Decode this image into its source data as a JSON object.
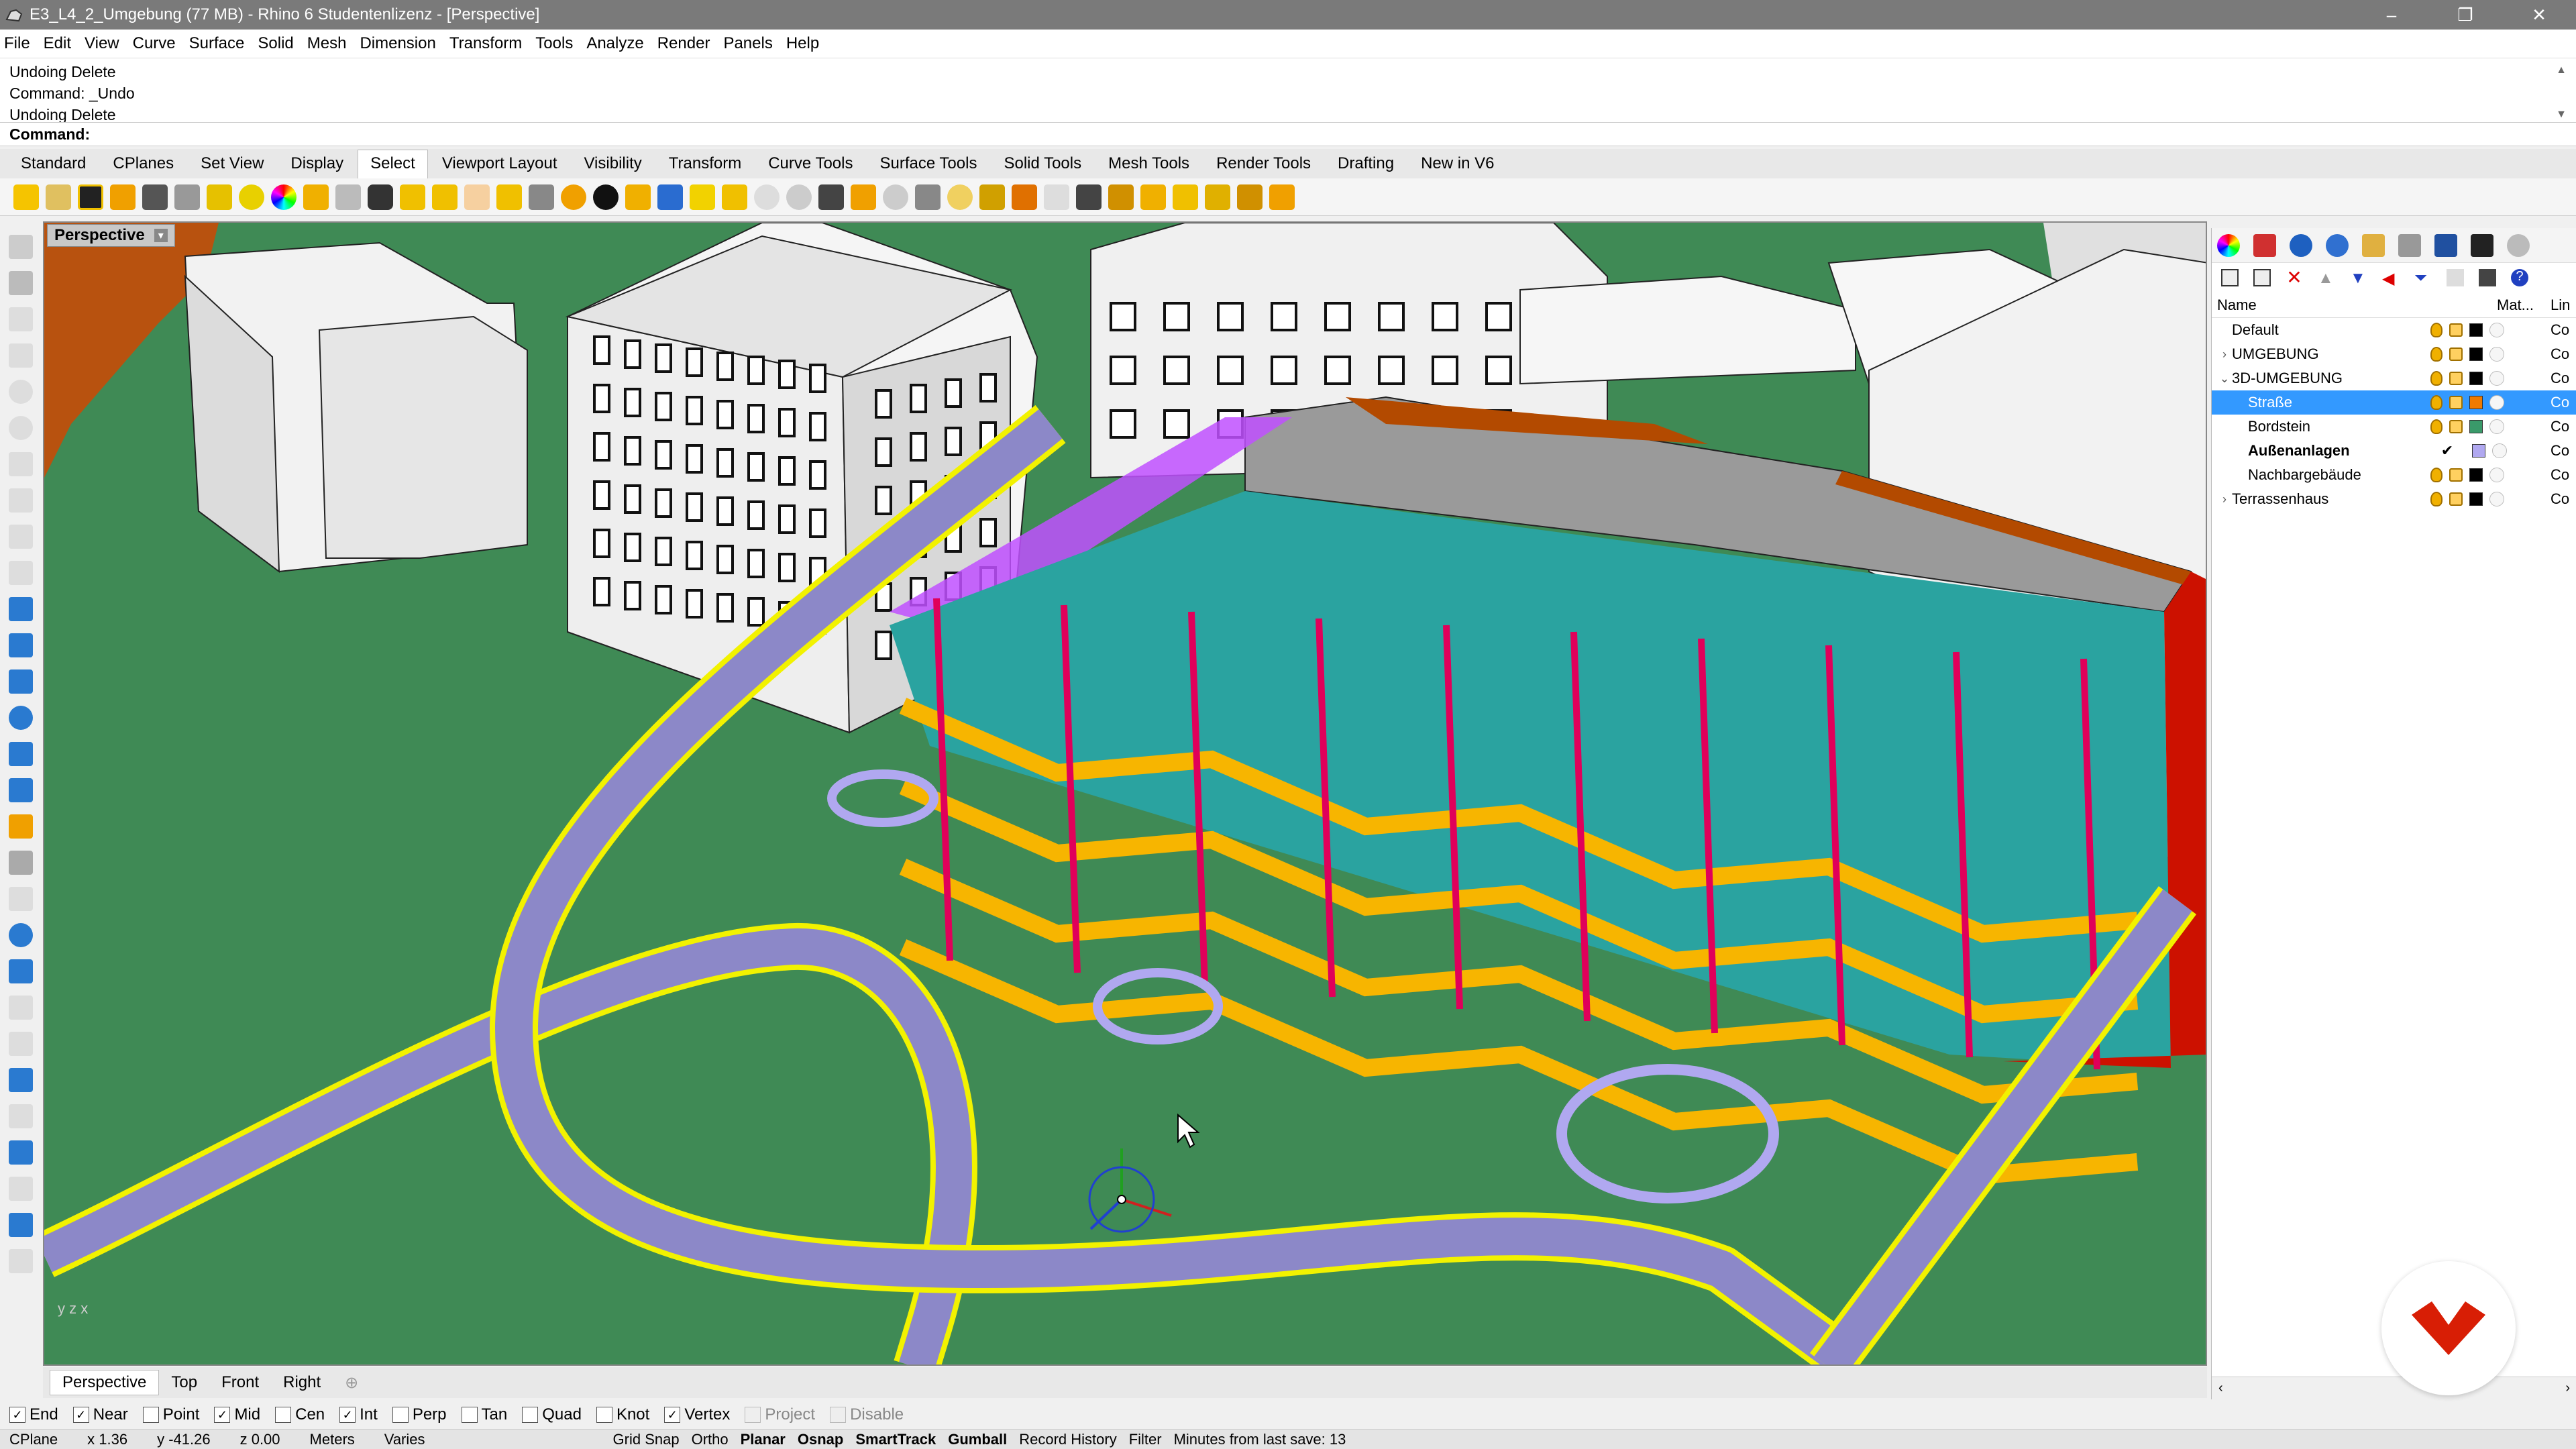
{
  "window": {
    "title": "E3_L4_2_Umgebung (77 MB) - Rhino 6 Studentenlizenz - [Perspective]",
    "min": "–",
    "max": "❐",
    "close": "✕"
  },
  "menu": [
    "File",
    "Edit",
    "View",
    "Curve",
    "Surface",
    "Solid",
    "Mesh",
    "Dimension",
    "Transform",
    "Tools",
    "Analyze",
    "Render",
    "Panels",
    "Help"
  ],
  "command": {
    "history": [
      "Undoing Delete",
      "Command: _Undo",
      "Undoing Delete"
    ],
    "prompt": "Command:"
  },
  "toolbar_tabs": [
    "Standard",
    "CPlanes",
    "Set View",
    "Display",
    "Select",
    "Viewport Layout",
    "Visibility",
    "Transform",
    "Curve Tools",
    "Surface Tools",
    "Solid Tools",
    "Mesh Tools",
    "Render Tools",
    "Drafting",
    "New in V6"
  ],
  "active_toolbar_tab": "Select",
  "viewport": {
    "name": "Perspective",
    "dropdown": "▾",
    "axis_labels": "y  z  x"
  },
  "viewport_tabs": [
    "Perspective",
    "Top",
    "Front",
    "Right",
    "⊕"
  ],
  "osnaps": [
    {
      "label": "End",
      "checked": true
    },
    {
      "label": "Near",
      "checked": true
    },
    {
      "label": "Point",
      "checked": false
    },
    {
      "label": "Mid",
      "checked": true
    },
    {
      "label": "Cen",
      "checked": false
    },
    {
      "label": "Int",
      "checked": true
    },
    {
      "label": "Perp",
      "checked": false
    },
    {
      "label": "Tan",
      "checked": false
    },
    {
      "label": "Quad",
      "checked": false
    },
    {
      "label": "Knot",
      "checked": false
    },
    {
      "label": "Vertex",
      "checked": true
    },
    {
      "label": "Project",
      "checked": false,
      "disabled": true
    },
    {
      "label": "Disable",
      "checked": false,
      "disabled": true
    }
  ],
  "status": {
    "cplane": "CPlane",
    "x": "x 1.36",
    "y": "y -41.26",
    "z": "z 0.00",
    "units": "Meters",
    "layer": "Varies",
    "toggles": [
      {
        "label": "Grid Snap",
        "bold": false
      },
      {
        "label": "Ortho",
        "bold": false
      },
      {
        "label": "Planar",
        "bold": true
      },
      {
        "label": "Osnap",
        "bold": true
      },
      {
        "label": "SmartTrack",
        "bold": true
      },
      {
        "label": "Gumball",
        "bold": true
      },
      {
        "label": "Record History",
        "bold": false
      },
      {
        "label": "Filter",
        "bold": false
      }
    ],
    "save_info": "Minutes from last save: 13"
  },
  "layers": {
    "headers": {
      "name": "Name",
      "material": "Mat...",
      "linetype": "Lin"
    },
    "rows": [
      {
        "name": "Default",
        "indent": 0,
        "arrow": "",
        "color": "#000000",
        "selected": false,
        "current": false,
        "lin": "Co"
      },
      {
        "name": "UMGEBUNG",
        "indent": 0,
        "arrow": "›",
        "color": "#000000",
        "selected": false,
        "current": false,
        "lin": "Co"
      },
      {
        "name": "3D-UMGEBUNG",
        "indent": 0,
        "arrow": "⌄",
        "color": "#000000",
        "selected": false,
        "current": false,
        "lin": "Co"
      },
      {
        "name": "Straße",
        "indent": 1,
        "arrow": "",
        "color": "#f07a00",
        "selected": true,
        "current": false,
        "lin": "Co"
      },
      {
        "name": "Bordstein",
        "indent": 1,
        "arrow": "",
        "color": "#3a9a6a",
        "selected": false,
        "current": false,
        "lin": "Co"
      },
      {
        "name": "Außenanlagen",
        "indent": 1,
        "arrow": "",
        "color": "#b0a8f0",
        "selected": false,
        "current": true,
        "lin": "Co"
      },
      {
        "name": "Nachbargebäude",
        "indent": 1,
        "arrow": "",
        "color": "#000000",
        "selected": false,
        "current": false,
        "lin": "Co"
      },
      {
        "name": "Terrassenhaus",
        "indent": 0,
        "arrow": "›",
        "color": "#000000",
        "selected": false,
        "current": false,
        "lin": "Co"
      }
    ]
  },
  "colors": {
    "ground": "#3f8a55",
    "road": "#8c88c8",
    "road_edge": "#f2f200",
    "glass": "#2aa3a0",
    "balcony": "#f7b500",
    "frame": "#e0005a",
    "side": "#cc1100",
    "roof": "#9a9a9a",
    "brand": "#d81e05"
  }
}
